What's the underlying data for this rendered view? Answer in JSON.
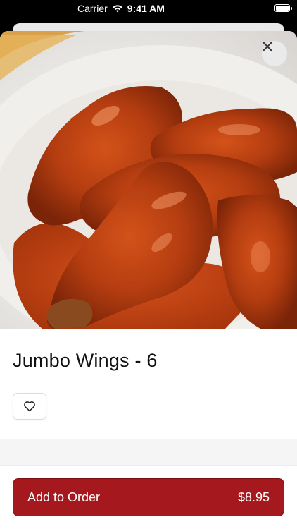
{
  "status_bar": {
    "carrier": "Carrier",
    "time": "9:41 AM"
  },
  "item": {
    "title": "Jumbo Wings - 6"
  },
  "actions": {
    "add_label": "Add to Order",
    "price": "$8.95"
  },
  "colors": {
    "accent": "#a5191e",
    "sauce": "#b8400f"
  },
  "icons": {
    "close": "close-icon",
    "favorite": "heart-icon",
    "wifi": "wifi-icon",
    "battery": "battery-icon"
  }
}
